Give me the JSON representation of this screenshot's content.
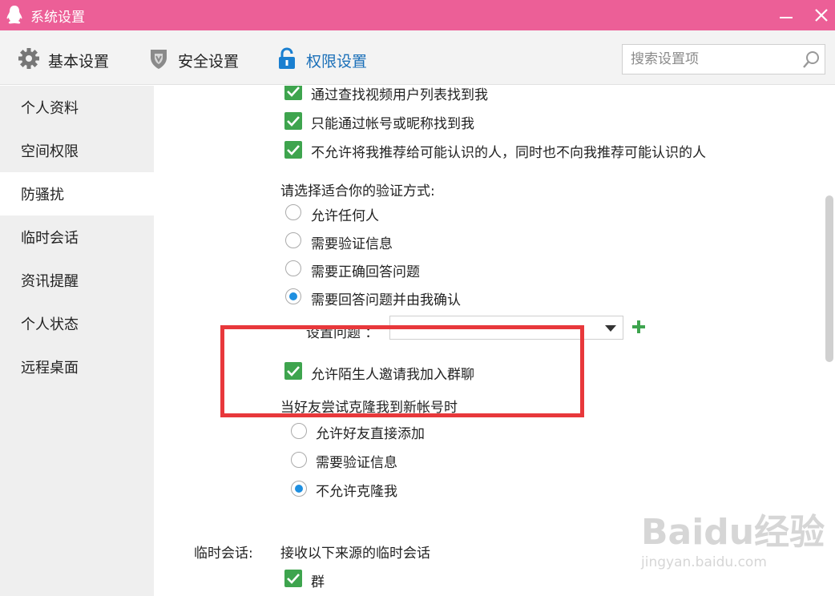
{
  "window": {
    "title": "系统设置"
  },
  "tabs": [
    {
      "label": "基本设置",
      "icon": "gear-icon"
    },
    {
      "label": "安全设置",
      "icon": "shield-icon"
    },
    {
      "label": "权限设置",
      "icon": "lock-icon",
      "active": true
    }
  ],
  "search": {
    "placeholder": "搜索设置项"
  },
  "sidebar": {
    "items": [
      {
        "label": "个人资料"
      },
      {
        "label": "空间权限"
      },
      {
        "label": "防骚扰",
        "active": true
      },
      {
        "label": "临时会话"
      },
      {
        "label": "资讯提醒"
      },
      {
        "label": "个人状态"
      },
      {
        "label": "远程桌面"
      }
    ]
  },
  "content": {
    "find_options": [
      {
        "label": "通过查找视频用户列表找到我",
        "checked": true
      },
      {
        "label": "只能通过帐号或昵称找到我",
        "checked": true
      },
      {
        "label": "不允许将我推荐给可能认识的人，同时也不向我推荐可能认识的人",
        "checked": true
      }
    ],
    "verify_heading": "请选择适合你的验证方式:",
    "verify_options": [
      {
        "label": "允许任何人",
        "selected": false
      },
      {
        "label": "需要验证信息",
        "selected": false
      },
      {
        "label": "需要正确回答问题",
        "selected": false
      },
      {
        "label": "需要回答问题并由我确认",
        "selected": true
      }
    ],
    "question_label": "设置问题  ：",
    "question_value": "",
    "group_invite": {
      "label": "允许陌生人邀请我加入群聊",
      "checked": true
    },
    "clone_heading": "当好友尝试克隆我到新帐号时",
    "clone_options": [
      {
        "label": "允许好友直接添加",
        "selected": false
      },
      {
        "label": "需要验证信息",
        "selected": false
      },
      {
        "label": "不允许克隆我",
        "selected": true
      }
    ],
    "temp_chat": {
      "section_label": "临时会话:",
      "heading": "接收以下来源的临时会话",
      "options": [
        {
          "label": "群",
          "checked": true
        }
      ]
    }
  },
  "watermark": {
    "main": "Baidu经验",
    "sub": "jingyan.baidu.com"
  },
  "colors": {
    "titlebar": "#ec5f97",
    "checkbox": "#3ea44e",
    "radio": "#1e8fe0",
    "highlight": "#e8383b",
    "active_tab": "#1a6fb8"
  }
}
